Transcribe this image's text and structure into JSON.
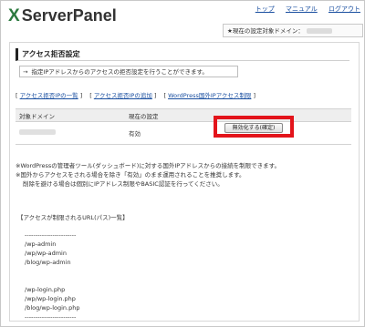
{
  "header": {
    "logo_x": "X",
    "logo_text": "ServerPanel",
    "nav": [
      {
        "label": "トップ"
      },
      {
        "label": "マニュアル"
      },
      {
        "label": "ログアウト"
      }
    ],
    "current_domain_label": "★現在の設定対象ドメイン："
  },
  "main": {
    "section_title": "アクセス拒否設定",
    "info_arrow": "→",
    "info_text": "指定IPアドレスからのアクセスの拒否設定を行うことができます。",
    "tabs": [
      {
        "label": "アクセス拒否IPの一覧"
      },
      {
        "label": "アクセス拒否IPの追加"
      },
      {
        "label": "WordPress国外IPアクセス制限"
      }
    ],
    "table": {
      "headers": [
        "対象ドメイン",
        "現在の設定",
        ""
      ],
      "row": {
        "status": "有効",
        "button_label": "無効化する(確定)"
      }
    },
    "notes": [
      "※WordPressの管理者ツール(ダッシュボード)に対する国外IPアドレスからの接続を制限できます。",
      "※国外からアクセスをされる場合を除き「有効」のまま運用されることを推奨します。",
      "削除を避ける場合は個別にIPアドレス制限やBASIC認証を行ってください。"
    ],
    "urls_title": "【アクセスが制限されるURL(パス)一覧】",
    "urls": [
      "------------------------",
      "/wp-admin",
      "/wp/wp-admin",
      "/blog/wp-admin",
      "",
      "",
      "/wp-login.php",
      "/wp/wp-login.php",
      "/blog/wp-login.php",
      "------------------------"
    ]
  },
  "colors": {
    "accent_green": "#2c7a3f",
    "link_blue": "#1a4fa0",
    "highlight_red": "#e3141b"
  }
}
